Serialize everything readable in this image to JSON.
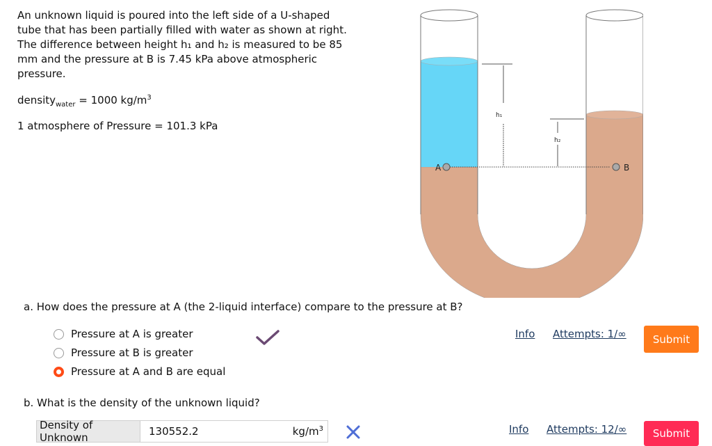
{
  "problem": {
    "lines": [
      "An unknown liquid is poured into the left side of a U-shaped",
      "tube that has been partially filled with water as shown at right.",
      "The difference between height h₁ and h₂ is measured to be 85",
      "mm and the pressure at B is 7.45 kPa above atmospheric",
      "pressure."
    ],
    "density_main": "density",
    "density_sub": "water",
    "density_value": " = 1000 kg/m",
    "density_sup": "3",
    "atmosphere": "1 atmosphere of Pressure = 101.3 kPa"
  },
  "diagram": {
    "label_h1": "h₁",
    "label_h2": "h₂",
    "label_A": "A",
    "label_B": "B",
    "colors": {
      "unknown": "#66d6f7",
      "water": "#dba98c"
    }
  },
  "question_a": {
    "text": "a. How does the pressure at A (the 2-liquid interface) compare to the pressure at B?",
    "options": [
      "Pressure at A is greater",
      "Pressure at B is greater",
      "Pressure at A and B are equal"
    ],
    "selected_index": 2,
    "info": "Info",
    "attempts": "Attempts: 1/∞",
    "submit": "Submit"
  },
  "question_b": {
    "text": "b. What is the density of the unknown liquid?",
    "label": "Density of Unknown",
    "value": "130552.2",
    "unit": "kg/m",
    "unit_sup": "3",
    "info": "Info",
    "attempts": "Attempts: 12/∞",
    "submit": "Submit"
  }
}
